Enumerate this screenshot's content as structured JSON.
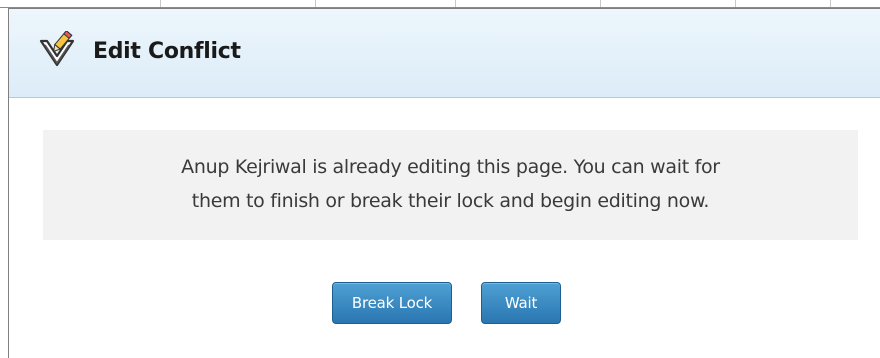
{
  "dialog": {
    "title": "Edit Conflict",
    "icon": "checkmark-pencil-icon",
    "message_line1": "Anup Kejriwal is already editing this page. You can wait for",
    "message_line2": "them to finish or break their lock and begin editing now."
  },
  "buttons": {
    "break_lock_label": "Break Lock",
    "wait_label": "Wait"
  },
  "colors": {
    "header_bg": "#dcecf8",
    "message_bg": "#f2f2f2",
    "button_bg": "#2a76b1"
  }
}
